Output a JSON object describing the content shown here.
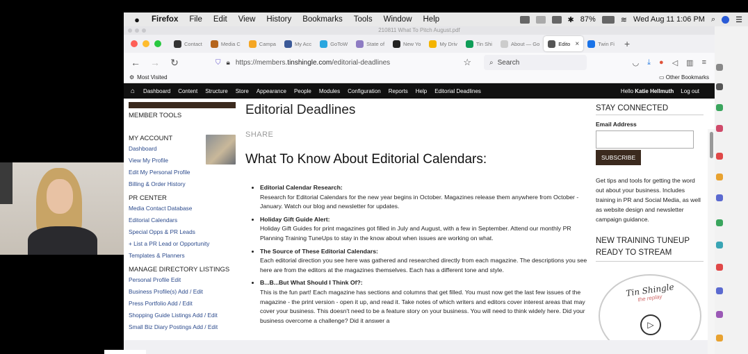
{
  "menubar": {
    "apple": "",
    "items": [
      "Firefox",
      "File",
      "Edit",
      "View",
      "History",
      "Bookmarks",
      "Tools",
      "Window",
      "Help"
    ],
    "battery": "87%",
    "clock": "Wed Aug 11  1:06 PM"
  },
  "pdf_title": "210811 What To Pitch August.pdf",
  "tabs": [
    {
      "label": "Contact",
      "color": "#333"
    },
    {
      "label": "Media C",
      "color": "#b5651d"
    },
    {
      "label": "Campa",
      "color": "#f5a623"
    },
    {
      "label": "My Acc",
      "color": "#3b5998"
    },
    {
      "label": "GoToW",
      "color": "#2aa6df"
    },
    {
      "label": "State of",
      "color": "#8e7cc3"
    },
    {
      "label": "New Yo",
      "color": "#222"
    },
    {
      "label": "My Driv",
      "color": "#f4b400"
    },
    {
      "label": "Tin Shi",
      "color": "#0f9d58"
    },
    {
      "label": "About — Go",
      "color": "#ccc"
    },
    {
      "label": "Edito",
      "color": "#555",
      "active": true
    },
    {
      "label": "Twin Fi",
      "color": "#1a73e8"
    }
  ],
  "url": {
    "prefix": "https://members.",
    "domain": "tinshingle.com",
    "path": "/editorial-deadlines"
  },
  "search_placeholder": "Search",
  "bookmarks": {
    "left": "Most Visited",
    "right": "Other Bookmarks"
  },
  "sitenav": {
    "items": [
      "Dashboard",
      "Content",
      "Structure",
      "Store",
      "Appearance",
      "People",
      "Modules",
      "Configuration",
      "Reports",
      "Help",
      "Editorial Deadlines"
    ],
    "hello": "Hello",
    "user": "Katie Hellmuth",
    "logout": "Log out"
  },
  "left_sidebar": {
    "title": "MEMBER TOOLS",
    "sections": [
      {
        "heading": "MY ACCOUNT",
        "links": [
          "Dashboard",
          "View My Profile",
          "Edit My Personal Profile",
          "Billing & Order History"
        ]
      },
      {
        "heading": "PR CENTER",
        "links": [
          "Media Contact Database",
          "Editorial Calendars",
          "Special Opps & PR Leads",
          "+ List a PR Lead or Opportunity",
          "Templates & Planners"
        ]
      },
      {
        "heading": "MANAGE DIRECTORY LISTINGS",
        "links": [
          "Personal Profile Edit",
          "Business Profile(s) Add / Edit",
          "Press Portfolio Add / Edit",
          "Shopping Guide Listings Add / Edit",
          "Small Biz Diary Postings Add / Edit"
        ]
      }
    ]
  },
  "main": {
    "title": "Editorial Deadlines",
    "share": "SHARE",
    "subtitle": "What To Know About Editorial Calendars:",
    "items": [
      {
        "title": "Editorial Calendar Research:",
        "body": "Research for Editorial Calendars for the new year begins in October. Magazines release them anywhere from October - January. Watch our blog and newsletter for updates."
      },
      {
        "title": "Holiday Gift Guide Alert:",
        "body": "Holiday Gift Guides for print magazines got filled in July and August, with a few in September. Attend our monthly PR Planning Training TuneUps to stay in the know about when issues are working on what."
      },
      {
        "title": "The Source of These Editorial Calendars:",
        "body": "Each editorial direction you see here was gathered and researched directly from each magazine. The descriptions you see here are from the editors at the magazines themselves. Each has a different tone and style."
      },
      {
        "title": "B...B...But What Should I Think Of?:",
        "body": "This is the fun part! Each magazine has sections and columns that get filled. You must now get the last few issues of the magazine - the print version - open it up, and read it. Take notes of which writers and editors cover interest areas that may cover your business. This doesn't need to be a feature story on your business. You will need to think widely here. Did your business overcome a challenge? Did it answer a"
      }
    ]
  },
  "right_sidebar": {
    "stay_connected": "STAY CONNECTED",
    "email_label": "Email Address",
    "subscribe": "SUBSCRIBE",
    "tips": "Get tips and tools for getting the word out about your business. Includes training in PR and Social Media, as well as website design and newsletter campaign guidance.",
    "training": "NEW TRAINING TUNEUP READY TO STREAM",
    "podcast_title": "Tin Shingle",
    "podcast_sub": "the replay"
  }
}
